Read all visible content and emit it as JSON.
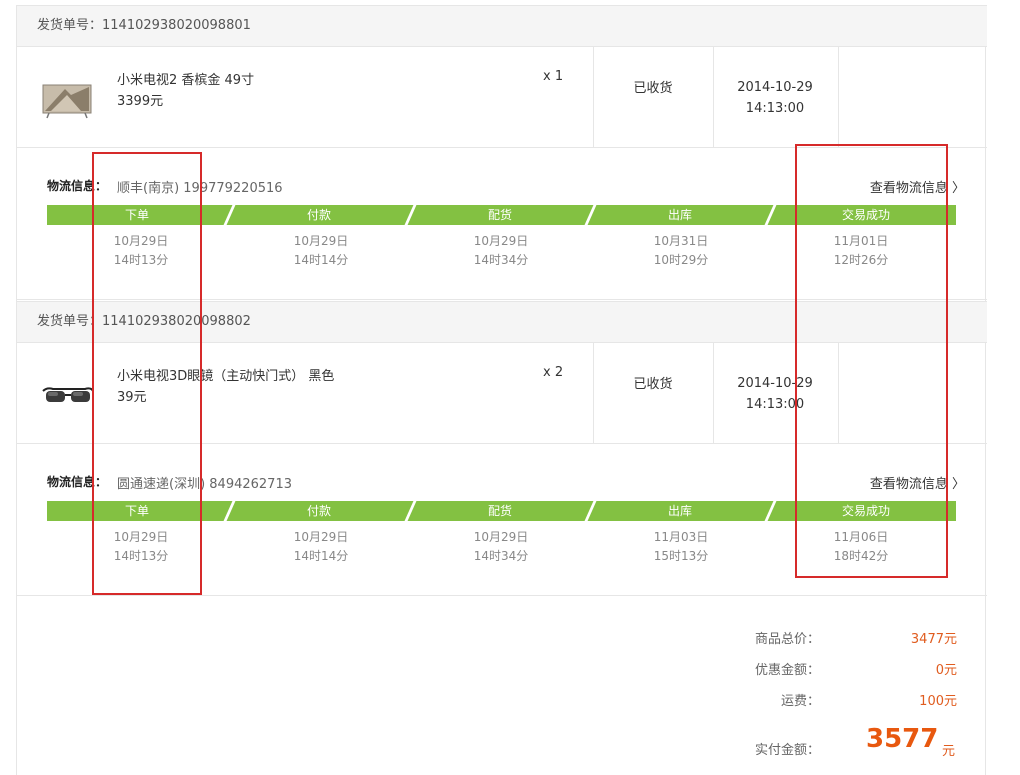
{
  "shipments": [
    {
      "number_label": "发货单号：",
      "number": "114102938020098801",
      "product": {
        "name": "小米电视2 香槟金 49寸",
        "price": "3399元",
        "qty": "x 1",
        "status": "已收货",
        "date": "2014-10-29",
        "time": "14:13:00",
        "icon": "tv-icon"
      },
      "logistics": {
        "label": "物流信息：",
        "value": "顺丰(南京) 199779220516",
        "link": "查看物流信息 〉",
        "steps": [
          {
            "name": "下单",
            "date": "10月29日",
            "time": "14时13分"
          },
          {
            "name": "付款",
            "date": "10月29日",
            "time": "14时14分"
          },
          {
            "name": "配货",
            "date": "10月29日",
            "time": "14时34分"
          },
          {
            "name": "出库",
            "date": "10月31日",
            "time": "10时29分"
          },
          {
            "name": "交易成功",
            "date": "11月01日",
            "time": "12时26分"
          }
        ]
      }
    },
    {
      "number_label": "发货单号：",
      "number": "114102938020098802",
      "product": {
        "name": "小米电视3D眼镜（主动快门式） 黑色",
        "price": "39元",
        "qty": "x 2",
        "status": "已收货",
        "date": "2014-10-29",
        "time": "14:13:00",
        "icon": "3d-glasses-icon"
      },
      "logistics": {
        "label": "物流信息：",
        "value": "圆通速递(深圳) 8494262713",
        "link": "查看物流信息 〉",
        "steps": [
          {
            "name": "下单",
            "date": "10月29日",
            "time": "14时13分"
          },
          {
            "name": "付款",
            "date": "10月29日",
            "time": "14时14分"
          },
          {
            "name": "配货",
            "date": "10月29日",
            "time": "14时34分"
          },
          {
            "name": "出库",
            "date": "11月03日",
            "time": "15时13分"
          },
          {
            "name": "交易成功",
            "date": "11月06日",
            "time": "18时42分"
          }
        ]
      }
    }
  ],
  "summary": {
    "goods_total_label": "商品总价：",
    "goods_total": "3477元",
    "discount_label": "优惠金额：",
    "discount": "0元",
    "shipping_label": "运费：",
    "shipping": "100元",
    "paid_label": "实付金额：",
    "paid": "3577",
    "paid_unit": "元"
  },
  "colors": {
    "progress_green": "#83c142",
    "price_orange": "#e8580f",
    "annotation_red": "#d62a2a"
  }
}
